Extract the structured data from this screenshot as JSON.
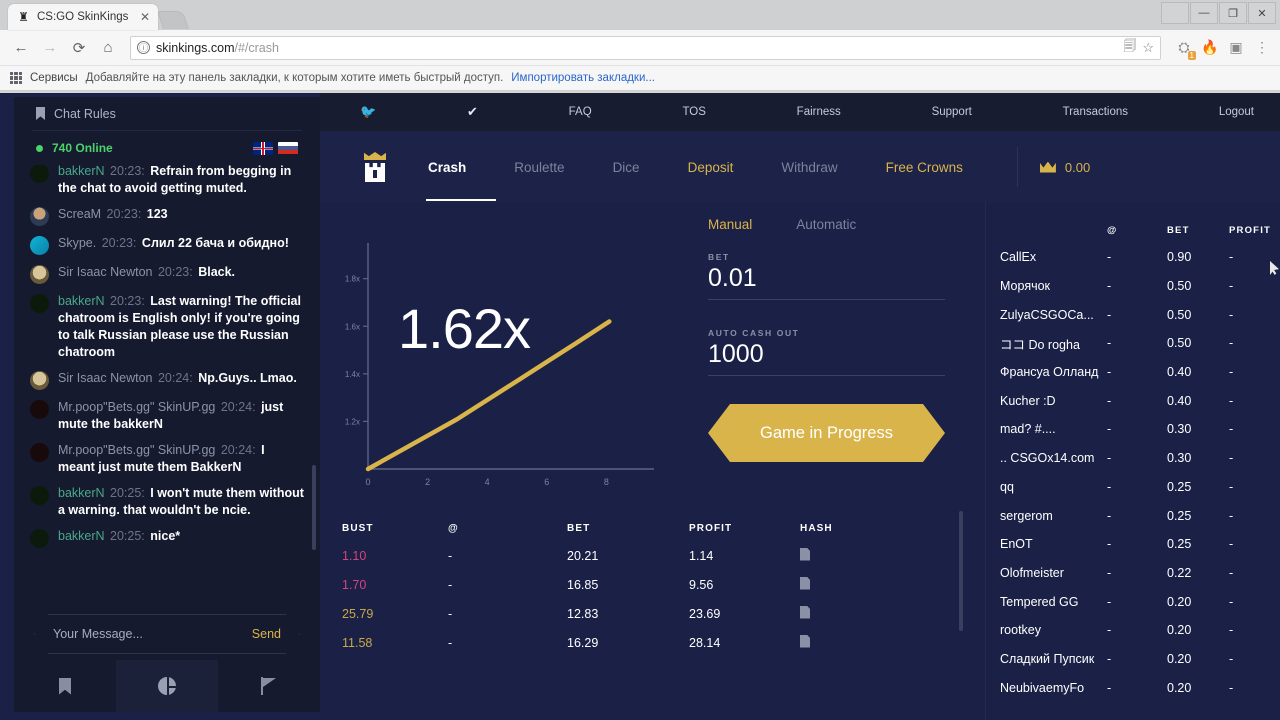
{
  "browser": {
    "tab_title": "CS:GO SkinKings",
    "tab_favicon": "chess-rook-icon",
    "tab_close": "✕",
    "nav": {
      "back": "←",
      "forward": "→",
      "reload": "⟳",
      "home": "⌂"
    },
    "omnibox": {
      "scheme_icon": "ⓘ",
      "url_bold": "skinkings.com",
      "url_rest": "/#/crash",
      "translate_icon": "translate-icon",
      "star_icon": "☆"
    },
    "window": {
      "profile": "person-icon",
      "minimize": "—",
      "maximize": "❐",
      "close": "✕"
    },
    "extensions": {
      "badge": "1"
    },
    "bookmarks": {
      "services_label": "Сервисы",
      "hint": "Добавляйте на эту панель закладки, к которым хотите иметь быстрый доступ.",
      "import_link": "Импортировать закладки..."
    }
  },
  "chat": {
    "rules_label": "Chat Rules",
    "online_count": "740 Online",
    "flags": [
      "flag-uk",
      "flag-ru"
    ],
    "messages": [
      {
        "avatar": "av-green",
        "user": "bakkerN",
        "user_color": "green",
        "time": "20:23:",
        "text": "Refrain from begging in the chat to avoid getting muted.",
        "clipped": true
      },
      {
        "avatar": "av-face",
        "user": "ScreaM",
        "user_color": "gray",
        "time": "20:23:",
        "text": "123"
      },
      {
        "avatar": "av-cyan",
        "user": "Skype.",
        "user_color": "gray",
        "time": "20:23:",
        "text": "Слил 22 бача и обидно!"
      },
      {
        "avatar": "av-newton",
        "user": "Sir Isaac Newton",
        "user_color": "gray",
        "time": "20:23:",
        "text": "Black."
      },
      {
        "avatar": "av-green",
        "user": "bakkerN",
        "user_color": "green",
        "time": "20:23:",
        "text": "Last warning! The official chatroom is English only! if you're going to talk Russian please use the Russian chatroom"
      },
      {
        "avatar": "av-newton",
        "user": "Sir Isaac Newton",
        "user_color": "gray",
        "time": "20:24:",
        "text": "Np.Guys.. Lmao."
      },
      {
        "avatar": "av-red",
        "user": "Mr.poop\"Bets.gg\" SkinUP.gg",
        "user_color": "gray",
        "time": "20:24:",
        "text": "just mute the bakkerN"
      },
      {
        "avatar": "av-red",
        "user": "Mr.poop\"Bets.gg\" SkinUP.gg",
        "user_color": "gray",
        "time": "20:24:",
        "text": "I meant just mute them BakkerN"
      },
      {
        "avatar": "av-green",
        "user": "bakkerN",
        "user_color": "green",
        "time": "20:25:",
        "text": "I won't mute them without a warning. that wouldn't be ncie."
      },
      {
        "avatar": "av-green",
        "user": "bakkerN",
        "user_color": "green",
        "time": "20:25:",
        "text": "nice*"
      }
    ],
    "input_placeholder": "Your Message...",
    "send_label": "Send",
    "tabs": [
      {
        "icon": "bookmark-icon",
        "active": false
      },
      {
        "icon": "pie-chart-icon",
        "active": true
      },
      {
        "icon": "flag-icon",
        "active": false
      }
    ]
  },
  "topbar": {
    "twitter_icon": "twitter-icon",
    "steam_icon": "check-icon",
    "links": [
      "FAQ",
      "TOS",
      "Fairness",
      "Support",
      "Transactions",
      "Logout"
    ]
  },
  "navbar": {
    "logo": "crown-rook-logo",
    "items": [
      {
        "label": "Crash",
        "state": "active"
      },
      {
        "label": "Roulette",
        "state": "normal"
      },
      {
        "label": "Dice",
        "state": "normal"
      },
      {
        "label": "Deposit",
        "state": "gold"
      },
      {
        "label": "Withdraw",
        "state": "normal"
      },
      {
        "label": "Free Crowns",
        "state": "gold"
      }
    ],
    "balance": "0.00",
    "balance_icon": "crown-icon"
  },
  "game": {
    "multiplier": "1.62x",
    "mode_tabs": [
      {
        "label": "Manual",
        "active": true
      },
      {
        "label": "Automatic",
        "active": false
      }
    ],
    "bet_label": "BET",
    "bet_value": "0.01",
    "cashout_label": "AUTO CASH OUT",
    "cashout_value": "1000",
    "play_button": "Game in Progress"
  },
  "chart_data": {
    "type": "line",
    "title": "",
    "xlabel": "",
    "ylabel": "",
    "x": [
      0,
      1,
      2,
      3,
      4,
      5,
      6,
      7,
      8.1
    ],
    "y": [
      1.0,
      1.07,
      1.14,
      1.21,
      1.29,
      1.37,
      1.45,
      1.53,
      1.62
    ],
    "xticks": [
      0,
      2,
      4,
      6,
      8
    ],
    "ytick_labels": [
      "1.2x",
      "1.4x",
      "1.6x",
      "1.8x"
    ],
    "yticks": [
      1.2,
      1.4,
      1.6,
      1.8
    ],
    "xlim": [
      0,
      9.6
    ],
    "ylim": [
      1.0,
      1.95
    ],
    "grid": false,
    "line_color": "#d9b44a",
    "axis_color": "#5d6487",
    "legend": null,
    "annotations": [
      {
        "text": "1.62x",
        "type": "center-multiplier"
      }
    ]
  },
  "history": {
    "columns": [
      "BUST",
      "@",
      "BET",
      "PROFIT",
      "HASH"
    ],
    "rows": [
      {
        "bust": "1.10",
        "bust_class": "low",
        "at": "-",
        "bet": "20.21",
        "profit": "1.14",
        "hash": "hash-icon"
      },
      {
        "bust": "1.70",
        "bust_class": "low",
        "at": "-",
        "bet": "16.85",
        "profit": "9.56",
        "hash": "hash-icon"
      },
      {
        "bust": "25.79",
        "bust_class": "high",
        "at": "-",
        "bet": "12.83",
        "profit": "23.69",
        "hash": "hash-icon"
      },
      {
        "bust": "11.58",
        "bust_class": "high",
        "at": "-",
        "bet": "16.29",
        "profit": "28.14",
        "hash": "hash-icon"
      }
    ]
  },
  "players": {
    "columns": [
      "",
      "@",
      "BET",
      "PROFIT"
    ],
    "rows": [
      {
        "name": "CallEx",
        "at": "-",
        "bet": "0.90",
        "profit": "-"
      },
      {
        "name": "Морячок",
        "at": "-",
        "bet": "0.50",
        "profit": "-"
      },
      {
        "name": "ZulyaCSGOCa...",
        "at": "-",
        "bet": "0.50",
        "profit": "-"
      },
      {
        "name": "ココ Do rogha",
        "at": "-",
        "bet": "0.50",
        "profit": "-"
      },
      {
        "name": "Франсуа Олланд",
        "at": "-",
        "bet": "0.40",
        "profit": "-"
      },
      {
        "name": "Kucher :D",
        "at": "-",
        "bet": "0.40",
        "profit": "-"
      },
      {
        "name": "mad? #....",
        "at": "-",
        "bet": "0.30",
        "profit": "-"
      },
      {
        "name": ".. CSGOx14.com",
        "at": "-",
        "bet": "0.30",
        "profit": "-"
      },
      {
        "name": "qq",
        "at": "-",
        "bet": "0.25",
        "profit": "-"
      },
      {
        "name": "sergerom",
        "at": "-",
        "bet": "0.25",
        "profit": "-"
      },
      {
        "name": "EnOT",
        "at": "-",
        "bet": "0.25",
        "profit": "-"
      },
      {
        "name": "Olofmeister",
        "at": "-",
        "bet": "0.22",
        "profit": "-"
      },
      {
        "name": "Tempered GG",
        "at": "-",
        "bet": "0.20",
        "profit": "-"
      },
      {
        "name": "rootkey",
        "at": "-",
        "bet": "0.20",
        "profit": "-"
      },
      {
        "name": "Сладкий Пупсик",
        "at": "-",
        "bet": "0.20",
        "profit": "-"
      },
      {
        "name": "NeubivaemyFo",
        "at": "-",
        "bet": "0.20",
        "profit": "-"
      }
    ]
  },
  "colors": {
    "background": "#1a2046",
    "sidebar": "#151a2e",
    "topbar": "#171c30",
    "accent_gold": "#d9b44a",
    "online_green": "#4bd26a",
    "bust_low": "#d4457e"
  }
}
